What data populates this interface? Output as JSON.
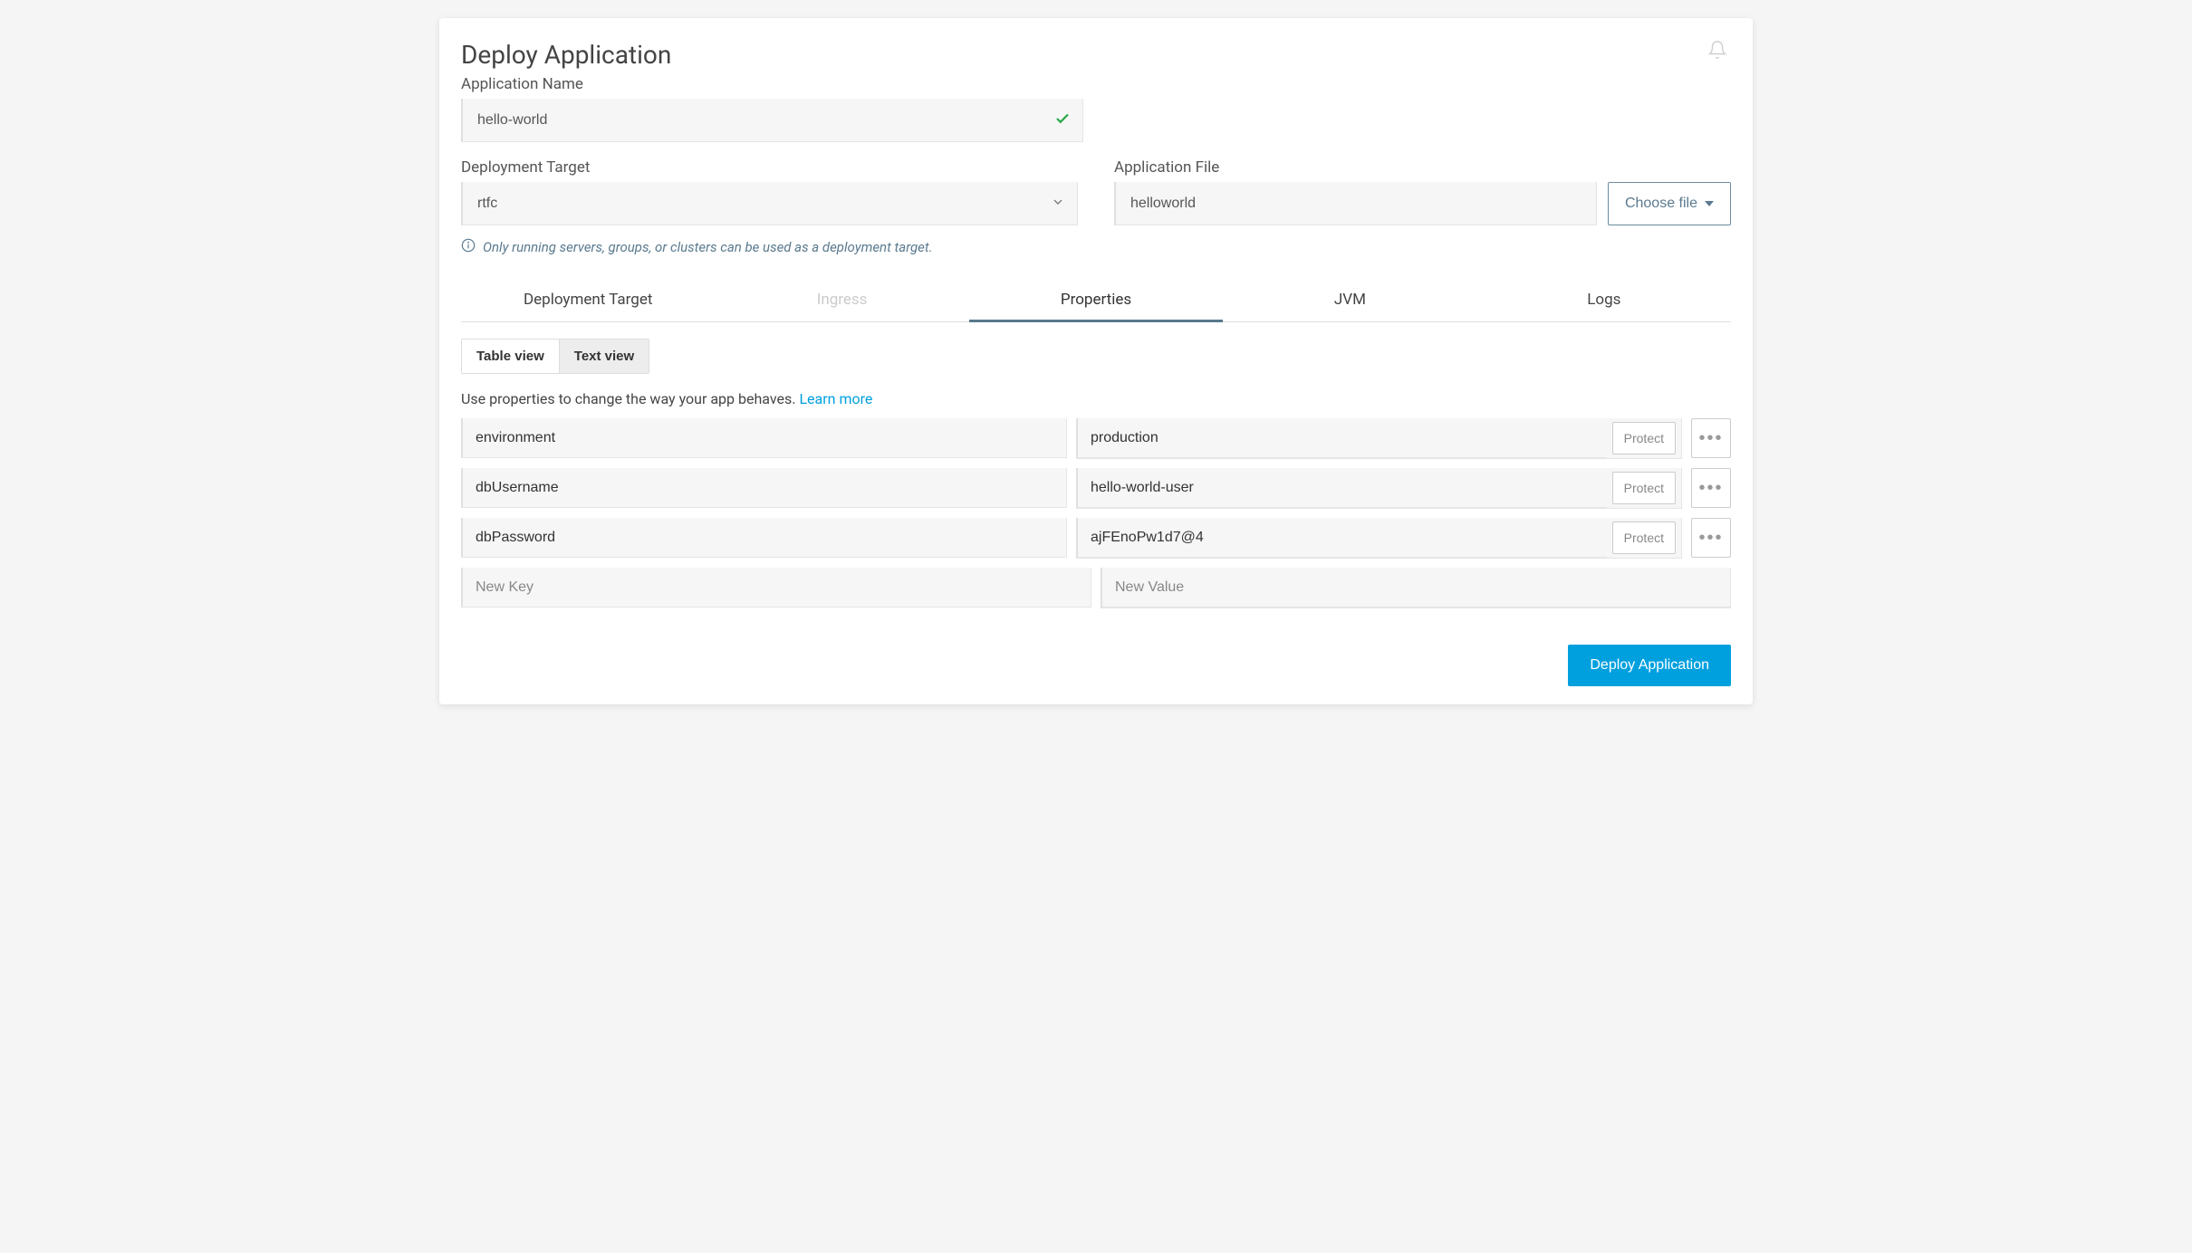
{
  "page": {
    "title": "Deploy Application"
  },
  "fields": {
    "app_name_label": "Application Name",
    "app_name_value": "hello-world",
    "deploy_target_label": "Deployment Target",
    "deploy_target_value": "rtfc",
    "app_file_label": "Application File",
    "app_file_value": "helloworld",
    "choose_file_label": "Choose file"
  },
  "info_note": "Only running servers, groups, or clusters can be used as a deployment target.",
  "tabs": [
    {
      "label": "Deployment Target",
      "active": false,
      "disabled": false
    },
    {
      "label": "Ingress",
      "active": false,
      "disabled": true
    },
    {
      "label": "Properties",
      "active": true,
      "disabled": false
    },
    {
      "label": "JVM",
      "active": false,
      "disabled": false
    },
    {
      "label": "Logs",
      "active": false,
      "disabled": false
    }
  ],
  "view_toggle": {
    "table": "Table view",
    "text": "Text view"
  },
  "help_text": "Use properties to change the way your app behaves. ",
  "learn_more": "Learn more",
  "properties": {
    "rows": [
      {
        "key": "environment",
        "value": "production"
      },
      {
        "key": "dbUsername",
        "value": "hello-world-user"
      },
      {
        "key": "dbPassword",
        "value": "ajFEnoPw1d7@4"
      }
    ],
    "protect_label": "Protect",
    "new_key_placeholder": "New Key",
    "new_value_placeholder": "New Value"
  },
  "footer": {
    "deploy_label": "Deploy Application"
  }
}
